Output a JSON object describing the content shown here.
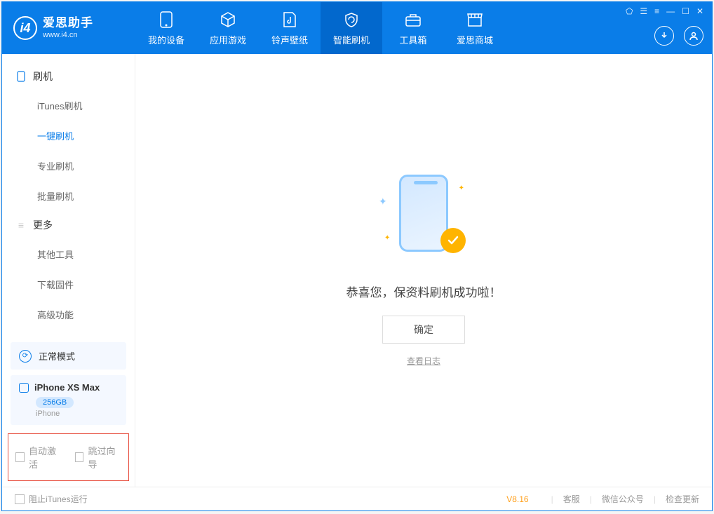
{
  "app": {
    "title": "爱思助手",
    "url": "www.i4.cn"
  },
  "nav": {
    "items": [
      {
        "label": "我的设备"
      },
      {
        "label": "应用游戏"
      },
      {
        "label": "铃声壁纸"
      },
      {
        "label": "智能刷机"
      },
      {
        "label": "工具箱"
      },
      {
        "label": "爱思商城"
      }
    ]
  },
  "sidebar": {
    "group1": {
      "title": "刷机",
      "items": [
        "iTunes刷机",
        "一键刷机",
        "专业刷机",
        "批量刷机"
      ]
    },
    "group2": {
      "title": "更多",
      "items": [
        "其他工具",
        "下载固件",
        "高级功能"
      ]
    }
  },
  "mode": {
    "label": "正常模式"
  },
  "device": {
    "name": "iPhone XS Max",
    "capacity": "256GB",
    "type": "iPhone"
  },
  "checks": {
    "auto_activate": "自动激活",
    "skip_guide": "跳过向导"
  },
  "main": {
    "message": "恭喜您，保资料刷机成功啦！",
    "ok_label": "确定",
    "log_label": "查看日志"
  },
  "footer": {
    "block_itunes": "阻止iTunes运行",
    "version": "V8.16",
    "links": [
      "客服",
      "微信公众号",
      "检查更新"
    ]
  }
}
